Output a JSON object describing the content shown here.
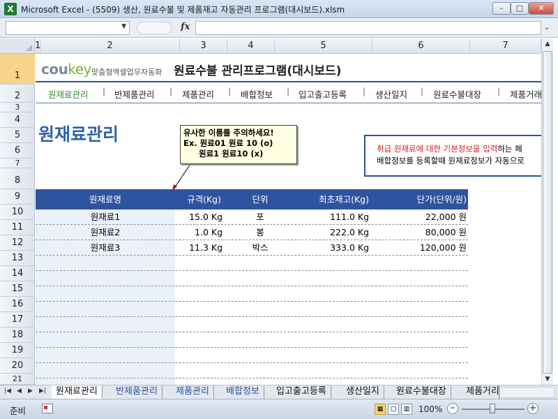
{
  "window": {
    "title": "Microsoft Excel - (5509) 생산, 원료수불 및 제품재고 자동관리 프로그램(대시보드).xlsm",
    "app_icon": "X",
    "min_glyph": "–",
    "max_glyph": "□",
    "close_glyph": "✕"
  },
  "formula_bar": {
    "name_box": "",
    "fx_label": "fx",
    "formula": ""
  },
  "columns": [
    "1",
    "2",
    "3",
    "4",
    "5",
    "6",
    "7"
  ],
  "rows": [
    "1",
    "2",
    "3",
    "4",
    "5",
    "6",
    "7",
    "8",
    "9",
    "10",
    "11",
    "12",
    "13",
    "14",
    "15",
    "16",
    "17",
    "18",
    "19",
    "20",
    "21"
  ],
  "header": {
    "logo_main": "cou",
    "logo_accent": "key",
    "logo_tagline": "맞춤형엑셀업무자동화",
    "app_title": "원료수불 관리프로그램(대시보드)"
  },
  "nav": {
    "items": [
      "원재료관리",
      "반제품관리",
      "제품관리",
      "배합정보",
      "입고출고등록",
      "생산일지",
      "원료수불대장",
      "제품거래"
    ],
    "separator": "|"
  },
  "page_heading": "원재료관리",
  "note": {
    "line1": "유사한 이름를 주의하세요!",
    "line2": "Ex.  원료01 원료 10 (o)",
    "line3": "원료1 원료10 (x)"
  },
  "info": {
    "line1_red": "취급 원재료에 대한 기본정보을 입력",
    "line1_rest": "하는 페",
    "line2": "배합정보를 등록할때 원재료정보가 자동으로"
  },
  "table": {
    "headers": [
      "원재료명",
      "규격(Kg)",
      "단위",
      "최초재고(Kg)",
      "단가(단위/원)"
    ],
    "rows": [
      [
        "원재료1",
        "15.0 Kg",
        "포",
        "111.0 Kg",
        "22,000 원"
      ],
      [
        "원재료2",
        "1.0 Kg",
        "봉",
        "222.0 Kg",
        "80,000 원"
      ],
      [
        "원재료3",
        "11.3 Kg",
        "박스",
        "333.0 Kg",
        "120,000 원"
      ]
    ]
  },
  "sheet_tabs": [
    "원재료관리",
    "반제품관리",
    "제품관리",
    "배합정보",
    "입고출고등록",
    "생산일지",
    "원료수불대장",
    "제품거리"
  ],
  "status": {
    "ready": "준비",
    "zoom": "100%"
  },
  "colors": {
    "accent_blue": "#2e54a0",
    "heading_blue": "#2e62a8",
    "nav_active": "#2e8b2e",
    "warning_red": "#d02020"
  }
}
